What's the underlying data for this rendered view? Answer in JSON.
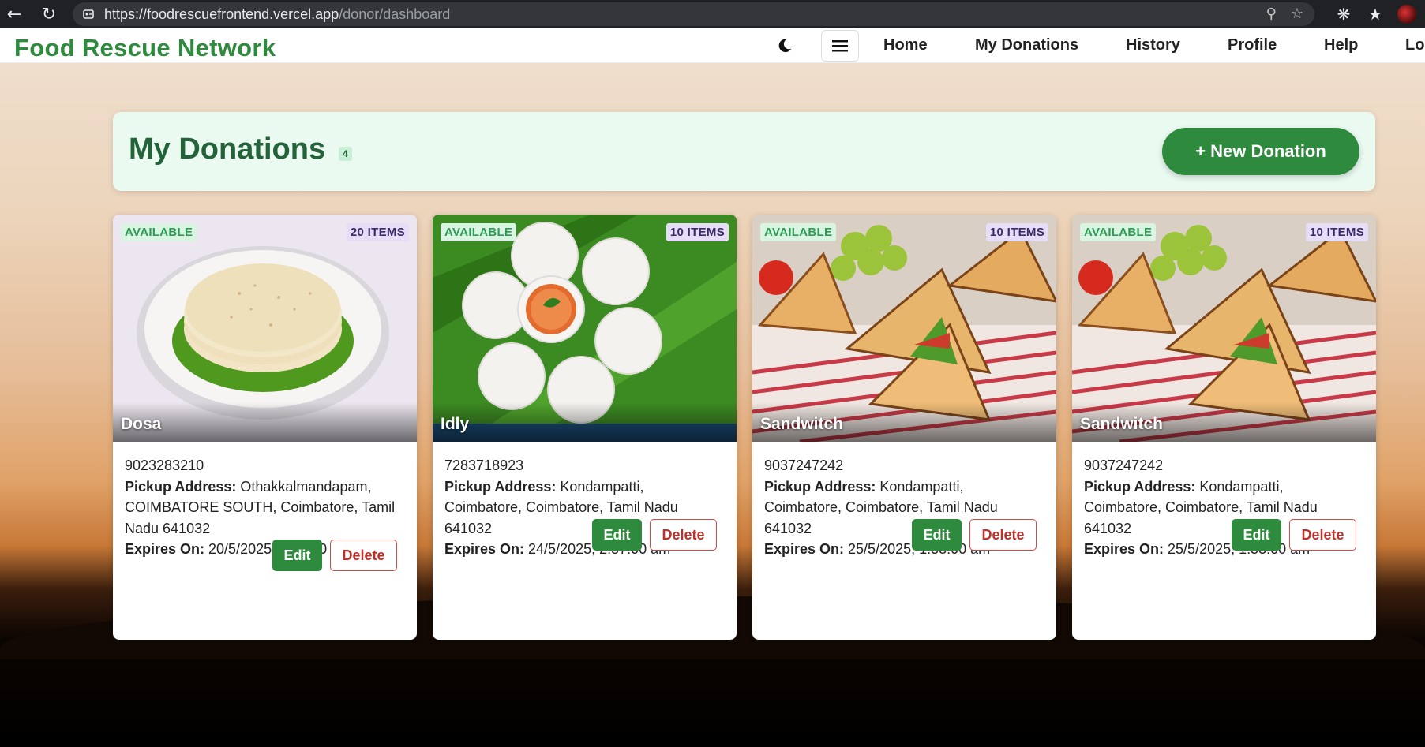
{
  "browser": {
    "url_host": "https://foodrescuefrontend.vercel.app",
    "url_path": "/donor/dashboard",
    "icons": [
      "back-arrow-icon",
      "reload-icon",
      "site-info-icon",
      "key-icon",
      "star-icon",
      "extensions-icon",
      "favorites-icon",
      "profile-avatar"
    ]
  },
  "navbar": {
    "brand": "Food Rescue Network",
    "links": [
      "Home",
      "My Donations",
      "History",
      "Profile",
      "Help",
      "Lo"
    ]
  },
  "header": {
    "title": "My Donations",
    "count": "4",
    "new_button": "+ New Donation"
  },
  "cards": [
    {
      "status": "AVAILABLE",
      "items": "20 ITEMS",
      "name": "Dosa",
      "phone": "9023283210",
      "pickup_label": "Pickup Address:",
      "pickup": " Othakkalmandapam, COIMBATORE SOUTH, Coimbatore, Tamil Nadu 641032",
      "expires_label": "Expires On:",
      "expires": " 20/5/2025, 9:20:00 pm",
      "edit": "Edit",
      "delete": "Delete"
    },
    {
      "status": "AVAILABLE",
      "items": "10 ITEMS",
      "name": "Idly",
      "phone": "7283718923",
      "pickup_label": "Pickup Address:",
      "pickup": " Kondampatti, Coimbatore, Coimbatore, Tamil Nadu 641032",
      "expires_label": "Expires On:",
      "expires": " 24/5/2025, 2:57:00 am",
      "edit": "Edit",
      "delete": "Delete"
    },
    {
      "status": "AVAILABLE",
      "items": "10 ITEMS",
      "name": "Sandwitch",
      "phone": "9037247242",
      "pickup_label": "Pickup Address:",
      "pickup": " Kondampatti, Coimbatore, Coimbatore, Tamil Nadu 641032",
      "expires_label": "Expires On:",
      "expires": " 25/5/2025, 1:53:00 am",
      "edit": "Edit",
      "delete": "Delete"
    },
    {
      "status": "AVAILABLE",
      "items": "10 ITEMS",
      "name": "Sandwitch",
      "phone": "9037247242",
      "pickup_label": "Pickup Address:",
      "pickup": " Kondampatti, Coimbatore, Coimbatore, Tamil Nadu 641032",
      "expires_label": "Expires On:",
      "expires": " 25/5/2025, 1:53:00 am",
      "edit": "Edit",
      "delete": "Delete"
    }
  ],
  "colors": {
    "brand_green": "#2e8b3e",
    "title_green": "#24623a",
    "header_bg": "#eafaf1",
    "status_badge_bg": "#d9f5e2",
    "items_badge_bg": "#e6ddf7",
    "delete_red": "#c0302a"
  }
}
